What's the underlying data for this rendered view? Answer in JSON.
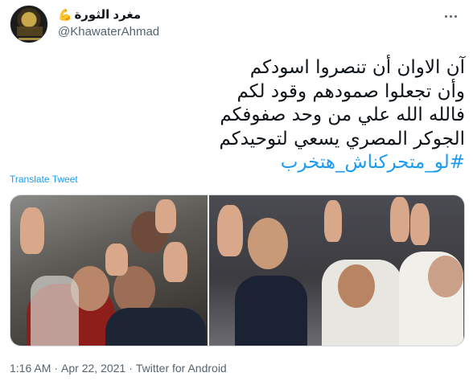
{
  "user": {
    "display_name": "مغرد الثورة",
    "emoji": "💪",
    "handle": "@KhawaterAhmad"
  },
  "tweet": {
    "lines": [
      "آن الاوان أن تنصروا اسودكم",
      "وأن تجعلوا صمودهم وقود لكم",
      "فالله الله علي من وحد صفوفكم",
      "الجوكر المصري يسعي لتوحيدكم"
    ],
    "hashtag": "#لو_متحركناش_هتخرب",
    "translate_label": "Translate Tweet"
  },
  "media": {
    "photos": [
      "photo-left",
      "photo-right"
    ]
  },
  "footer": {
    "time": "1:16 AM",
    "sep1": "·",
    "date": "Apr 22, 2021",
    "sep2": "·",
    "source": "Twitter for Android"
  },
  "colors": {
    "link": "#1d9bf0",
    "secondary_text": "#536471",
    "primary_text": "#0f1419"
  },
  "icons": [
    "more-options-icon",
    "flexed-biceps-emoji"
  ]
}
